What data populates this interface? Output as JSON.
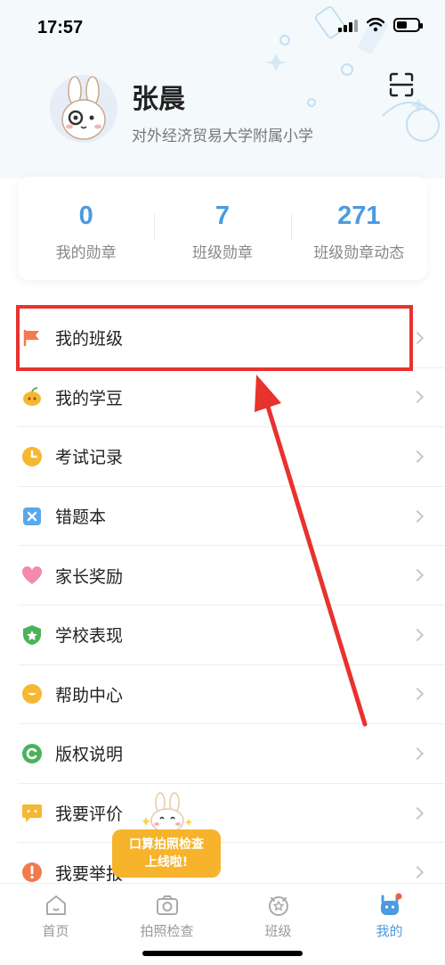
{
  "status_bar": {
    "time": "17:57"
  },
  "profile": {
    "name": "张晨",
    "school": "对外经济贸易大学附属小学"
  },
  "stats": [
    {
      "value": "0",
      "label": "我的勋章"
    },
    {
      "value": "7",
      "label": "班级勋章"
    },
    {
      "value": "271",
      "label": "班级勋章动态"
    }
  ],
  "menu": [
    {
      "label": "我的班级",
      "icon": "flag-icon"
    },
    {
      "label": "我的学豆",
      "icon": "bean-icon"
    },
    {
      "label": "考试记录",
      "icon": "clock-icon"
    },
    {
      "label": "错题本",
      "icon": "wrong-book-icon"
    },
    {
      "label": "家长奖励",
      "icon": "heart-icon"
    },
    {
      "label": "学校表现",
      "icon": "shield-star-icon"
    },
    {
      "label": "帮助中心",
      "icon": "help-icon"
    },
    {
      "label": "版权说明",
      "icon": "copyright-icon"
    },
    {
      "label": "我要评价",
      "icon": "comment-icon"
    },
    {
      "label": "我要举报",
      "icon": "report-icon"
    }
  ],
  "promo": {
    "line1": "口算拍照检查",
    "line2": "上线啦!"
  },
  "tabs": [
    {
      "label": "首页",
      "icon": "home-icon"
    },
    {
      "label": "拍照检查",
      "icon": "camera-icon"
    },
    {
      "label": "班级",
      "icon": "class-icon"
    },
    {
      "label": "我的",
      "icon": "profile-icon",
      "active": true
    }
  ],
  "colors": {
    "accent": "#4a9be0",
    "highlight": "#e8322e",
    "promo": "#f6b32b"
  }
}
